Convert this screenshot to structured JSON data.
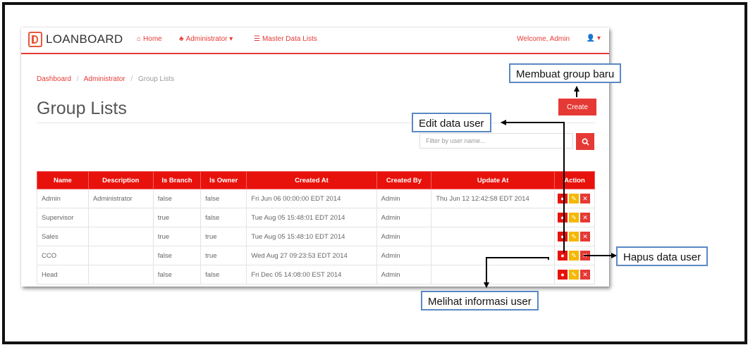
{
  "app": {
    "brand": "LOANBOARD",
    "nav": [
      {
        "label": "Home",
        "icon": "home-icon"
      },
      {
        "label": "Administrator ▾",
        "icon": "sitemap-icon"
      },
      {
        "label": "Master Data Lists",
        "icon": "list-icon"
      }
    ],
    "welcome": "Welcome, Admin",
    "user_menu": "▾"
  },
  "breadcrumb": [
    "Dashboard",
    "Administrator",
    "Group Lists"
  ],
  "page_title": "Group Lists",
  "create_label": "Create",
  "search": {
    "placeholder": "Filter by user name..."
  },
  "table": {
    "headers": [
      "Name",
      "Description",
      "Is Branch",
      "Is Owner",
      "Created At",
      "Created By",
      "Update At",
      "Action"
    ],
    "rows": [
      [
        "Admin",
        "Administrator",
        "false",
        "false",
        "Fri Jun 06 00:00:00 EDT 2014",
        "Admin",
        "Thu Jun 12 12:42:58 EDT 2014"
      ],
      [
        "Supervisor",
        "",
        "true",
        "false",
        "Tue Aug 05 15:48:01 EDT 2014",
        "Admin",
        ""
      ],
      [
        "Sales",
        "",
        "true",
        "true",
        "Tue Aug 05 15:48:10 EDT 2014",
        "Admin",
        ""
      ],
      [
        "CCO",
        "",
        "false",
        "true",
        "Wed Aug 27 09:23:53 EDT 2014",
        "Admin",
        ""
      ],
      [
        "Head",
        "",
        "false",
        "false",
        "Fri Dec 05 14:08:00 EST 2014",
        "Admin",
        ""
      ]
    ]
  },
  "annotations": {
    "create": "Membuat group baru",
    "edit": "Edit data user",
    "delete": "Hapus data user",
    "view": "Melihat informasi user"
  },
  "colors": {
    "accent": "#e53935",
    "header": "#e8120c",
    "edit": "#f5b800",
    "callout_border": "#5a88c5"
  }
}
